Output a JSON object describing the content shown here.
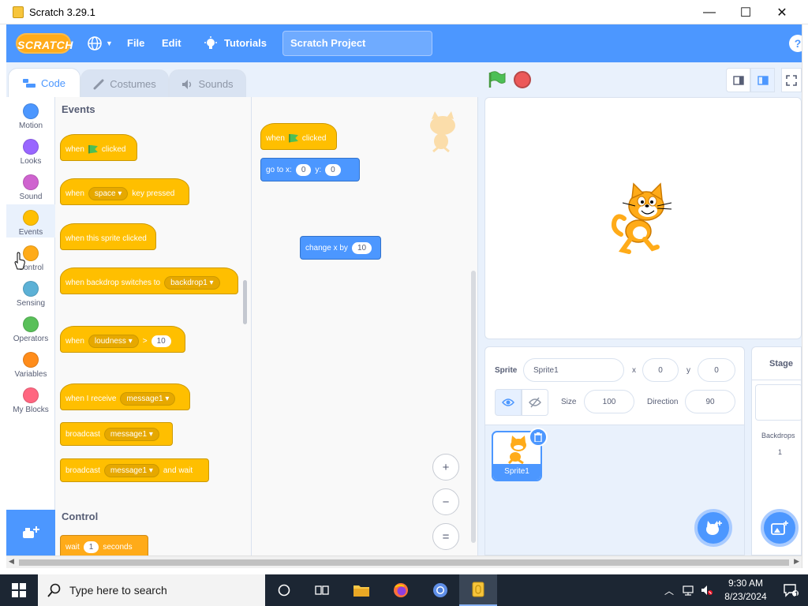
{
  "window": {
    "title": "Scratch 3.29.1",
    "minimize_glyph": "—",
    "maximize_glyph": "☐",
    "close_glyph": "✕"
  },
  "menubar": {
    "logo": "SCRATCH",
    "language_icon": "globe-icon",
    "file": "File",
    "edit": "Edit",
    "tutorials": "Tutorials",
    "project_title": "Scratch Project",
    "help_glyph": "?"
  },
  "tabs": [
    {
      "label": "Code",
      "icon": "code-icon"
    },
    {
      "label": "Costumes",
      "icon": "brush-icon"
    },
    {
      "label": "Sounds",
      "icon": "speaker-icon"
    }
  ],
  "categories": [
    {
      "label": "Motion",
      "color": "#4c97ff"
    },
    {
      "label": "Looks",
      "color": "#9966ff"
    },
    {
      "label": "Sound",
      "color": "#cf63cf"
    },
    {
      "label": "Events",
      "color": "#ffbf00"
    },
    {
      "label": "Control",
      "color": "#ffab19"
    },
    {
      "label": "Sensing",
      "color": "#5cb1d6"
    },
    {
      "label": "Operators",
      "color": "#59c059"
    },
    {
      "label": "Variables",
      "color": "#ff8c1a"
    },
    {
      "label": "My Blocks",
      "color": "#ff6680"
    }
  ],
  "palette": {
    "events_heading": "Events",
    "control_heading": "Control",
    "when": "when",
    "clicked": "clicked",
    "key_pressed": "key pressed",
    "space": "space",
    "when_sprite_clicked": "when this sprite clicked",
    "when_backdrop": "when backdrop switches to",
    "backdrop1": "backdrop1",
    "loudness": "loudness",
    "gt": ">",
    "ten": "10",
    "when_receive": "when I receive",
    "message1": "message1",
    "broadcast": "broadcast",
    "and_wait": "and wait",
    "wait": "wait",
    "one": "1",
    "seconds": "seconds"
  },
  "script": {
    "when": "when",
    "clicked": "clicked",
    "goto": "go to x:",
    "x_val": "0",
    "y_label": "y:",
    "y_val": "0",
    "change_x": "change x by",
    "change_val": "10",
    "zoom_in": "+",
    "zoom_out": "−",
    "zoom_reset": "="
  },
  "sprite_info": {
    "sprite_label": "Sprite",
    "sprite_name": "Sprite1",
    "x_label": "x",
    "x_value": "0",
    "y_label": "y",
    "y_value": "0",
    "show_label": "Show",
    "size_label": "Size",
    "size_value": "100",
    "direction_label": "Direction",
    "direction_value": "90"
  },
  "sprite_list": [
    {
      "name": "Sprite1"
    }
  ],
  "stage_panel": {
    "title": "Stage",
    "backdrops_label": "Backdrops",
    "backdrops_count": "1"
  },
  "taskbar": {
    "search_placeholder": "Type here to search",
    "time": "9:30 AM",
    "date": "8/23/2024",
    "notification_count": "1"
  }
}
